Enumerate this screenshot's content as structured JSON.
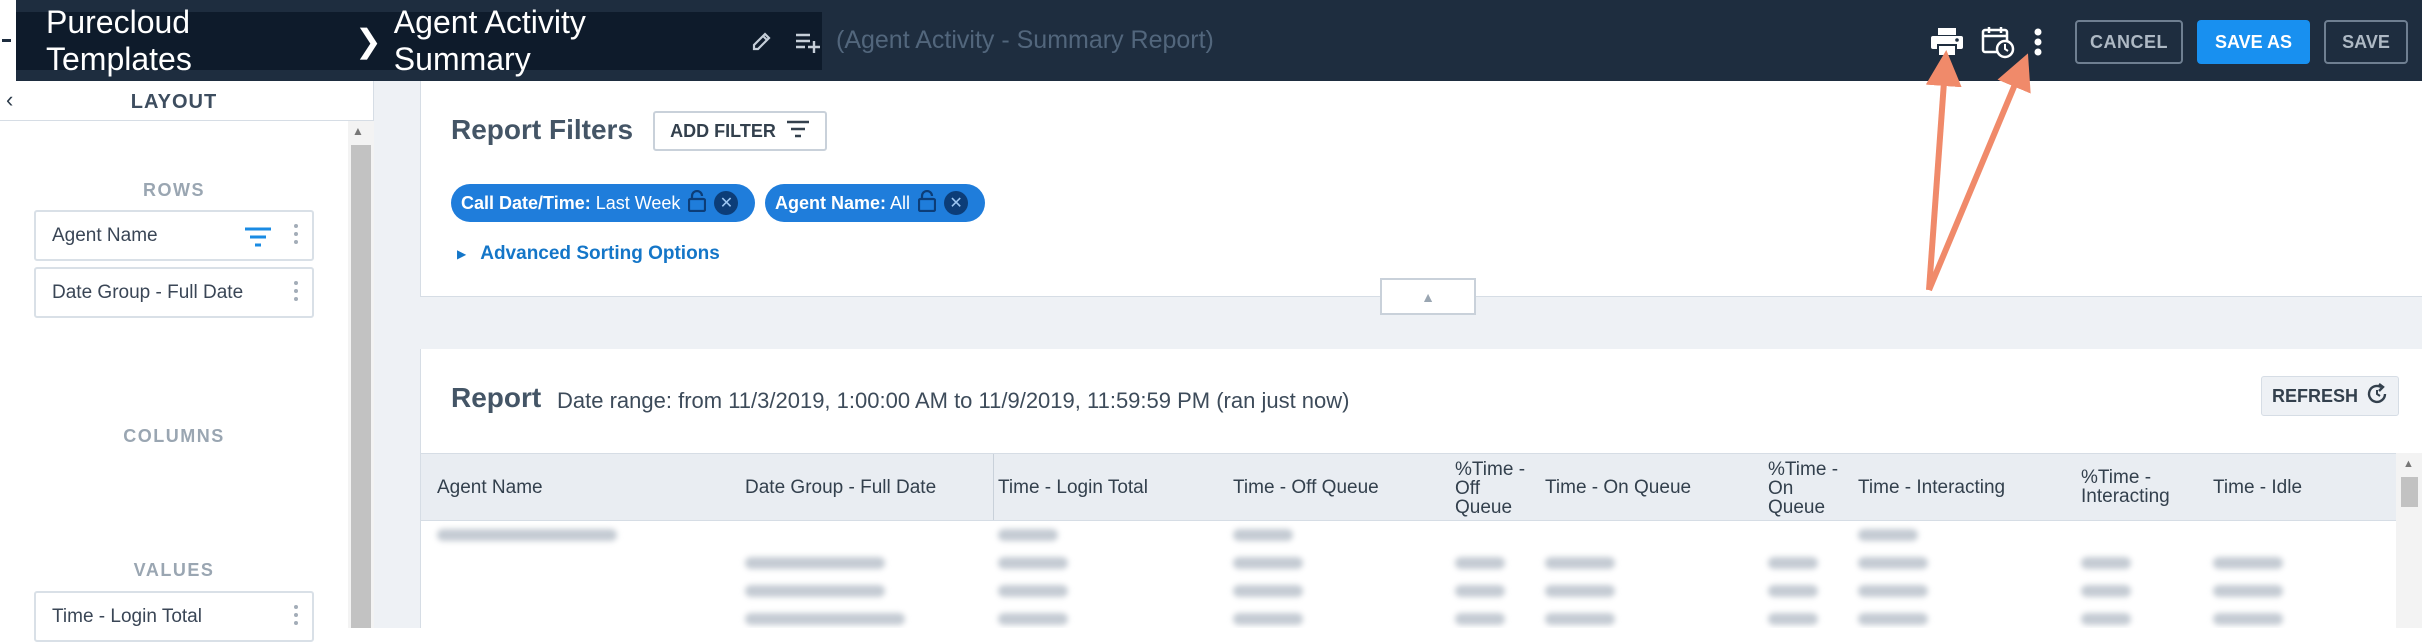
{
  "header": {
    "breadcrumb_parent": "Purecloud Templates",
    "report_name": "Agent Activity Summary",
    "report_subtitle": "(Agent Activity - Summary Report)",
    "cancel_label": "CANCEL",
    "save_as_label": "SAVE AS",
    "save_label": "SAVE",
    "icons": [
      "edit-icon",
      "add-to-list-icon",
      "print-icon",
      "schedule-icon",
      "more-vertical-icon"
    ]
  },
  "sidebar": {
    "title": "LAYOUT",
    "rows_label": "ROWS",
    "rows": [
      "Agent Name",
      "Date Group - Full Date"
    ],
    "columns_label": "COLUMNS",
    "values_label": "VALUES",
    "values": [
      "Time - Login Total"
    ]
  },
  "filters": {
    "title": "Report Filters",
    "add_filter_label": "ADD FILTER",
    "chips": [
      {
        "key": "Call Date/Time:",
        "value": " Last Week"
      },
      {
        "key": "Agent Name:",
        "value": " All"
      }
    ],
    "advanced_label": "Advanced Sorting Options"
  },
  "report": {
    "title": "Report",
    "date_range": "Date range: from 11/3/2019, 1:00:00 AM to 11/9/2019, 11:59:59 PM (ran just now)",
    "refresh_label": "REFRESH",
    "columns": [
      {
        "line1": "Agent Name",
        "line2": "",
        "line3": ""
      },
      {
        "line1": "Date Group - Full Date",
        "line2": "",
        "line3": ""
      },
      {
        "line1": "Time - Login Total",
        "line2": "",
        "line3": ""
      },
      {
        "line1": "Time - Off Queue",
        "line2": "",
        "line3": ""
      },
      {
        "line1": "%Time -",
        "line2": "Off",
        "line3": "Queue"
      },
      {
        "line1": "Time - On Queue",
        "line2": "",
        "line3": ""
      },
      {
        "line1": "%Time -",
        "line2": "On",
        "line3": "Queue"
      },
      {
        "line1": "Time - Interacting",
        "line2": "",
        "line3": ""
      },
      {
        "line1": "%Time -",
        "line2": "Interacting",
        "line3": ""
      },
      {
        "line1": "Time - Idle",
        "line2": "",
        "line3": ""
      }
    ]
  },
  "colors": {
    "topbar": "#1e2d3f",
    "title_box": "#0e1b2b",
    "primary_button": "#1890f0",
    "chip": "#1f7ddb",
    "link": "#1476c8",
    "annotation_arrow": "#f08a6a"
  }
}
